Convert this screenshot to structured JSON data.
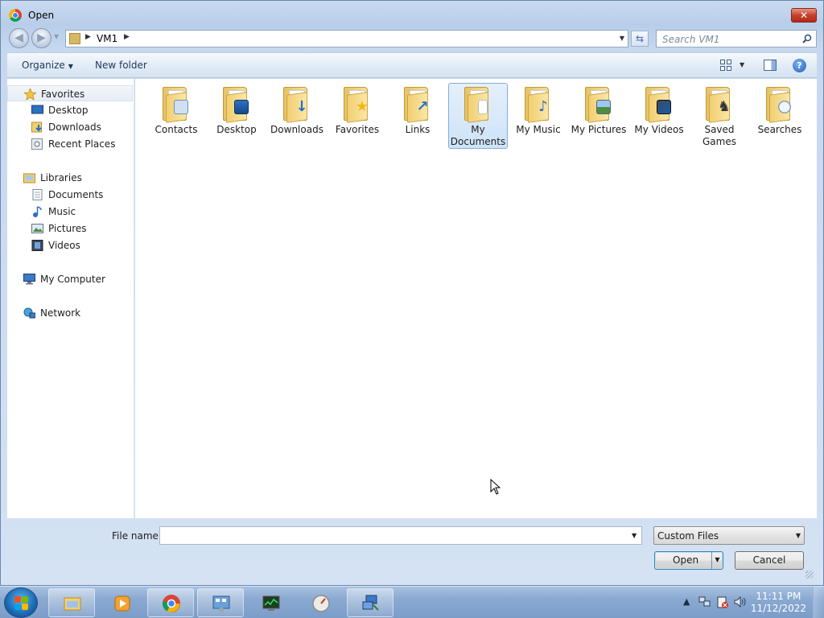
{
  "window": {
    "title": "Open",
    "close_label": "✕"
  },
  "nav": {
    "back_icon": "back-arrow-icon",
    "forward_icon": "forward-arrow-icon"
  },
  "address": {
    "path": "VM1"
  },
  "search": {
    "placeholder": "Search VM1"
  },
  "toolbar": {
    "organize_label": "Organize",
    "new_folder_label": "New folder",
    "help_label": "?"
  },
  "sidebar": {
    "favorites": {
      "label": "Favorites",
      "items": [
        {
          "label": "Desktop"
        },
        {
          "label": "Downloads"
        },
        {
          "label": "Recent Places"
        }
      ]
    },
    "libraries": {
      "label": "Libraries",
      "items": [
        {
          "label": "Documents"
        },
        {
          "label": "Music"
        },
        {
          "label": "Pictures"
        },
        {
          "label": "Videos"
        }
      ]
    },
    "computer": {
      "label": "My Computer"
    },
    "network": {
      "label": "Network"
    }
  },
  "files": [
    {
      "name": "Contacts",
      "icon": "contacts-folder-icon",
      "selected": false
    },
    {
      "name": "Desktop",
      "icon": "desktop-folder-icon",
      "selected": false
    },
    {
      "name": "Downloads",
      "icon": "downloads-folder-icon",
      "selected": false
    },
    {
      "name": "Favorites",
      "icon": "favorites-folder-icon",
      "selected": false
    },
    {
      "name": "Links",
      "icon": "links-folder-icon",
      "selected": false
    },
    {
      "name": "My Documents",
      "icon": "documents-folder-icon",
      "selected": true
    },
    {
      "name": "My Music",
      "icon": "music-folder-icon",
      "selected": false
    },
    {
      "name": "My Pictures",
      "icon": "pictures-folder-icon",
      "selected": false
    },
    {
      "name": "My Videos",
      "icon": "videos-folder-icon",
      "selected": false
    },
    {
      "name": "Saved Games",
      "icon": "saved-games-folder-icon",
      "selected": false
    },
    {
      "name": "Searches",
      "icon": "searches-folder-icon",
      "selected": false
    }
  ],
  "bottom": {
    "file_name_label": "File name:",
    "file_name_value": "",
    "file_type_value": "Custom Files",
    "open_label": "Open",
    "cancel_label": "Cancel"
  },
  "taskbar": {
    "apps": [
      "explorer-icon",
      "media-player-icon",
      "chrome-icon",
      "control-panel-icon",
      "task-manager-icon",
      "performance-icon",
      "network-app-icon"
    ],
    "time": "11:11 PM",
    "date": "11/12/2022"
  },
  "colors": {
    "accent": "#3c7fb1",
    "selection": "#cde3f8",
    "folder": "#f1cf72",
    "close": "#c7402a"
  }
}
